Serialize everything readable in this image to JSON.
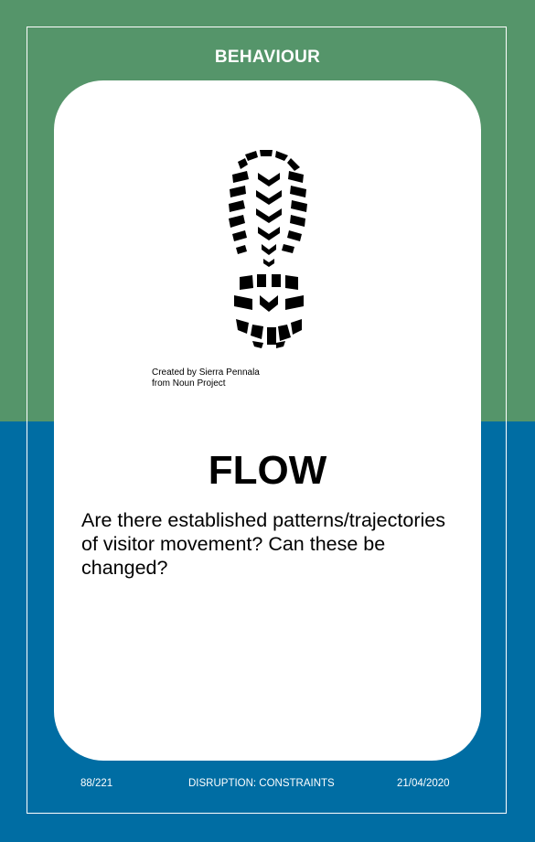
{
  "colors": {
    "top_band": "#55956a",
    "bottom_band": "#006da3",
    "panel": "#ffffff",
    "text": "#000000"
  },
  "card": {
    "category": "BEHAVIOUR",
    "icon": "boot-print-icon",
    "icon_credit_line1": "Created by Sierra Pennala",
    "icon_credit_line2": "from Noun Project",
    "title": "FLOW",
    "question": "Are there established patterns/trajectories of visitor movement? Can these be changed?"
  },
  "footer": {
    "card_number": "88/221",
    "section": "DISRUPTION: CONSTRAINTS",
    "date": "21/04/2020"
  }
}
